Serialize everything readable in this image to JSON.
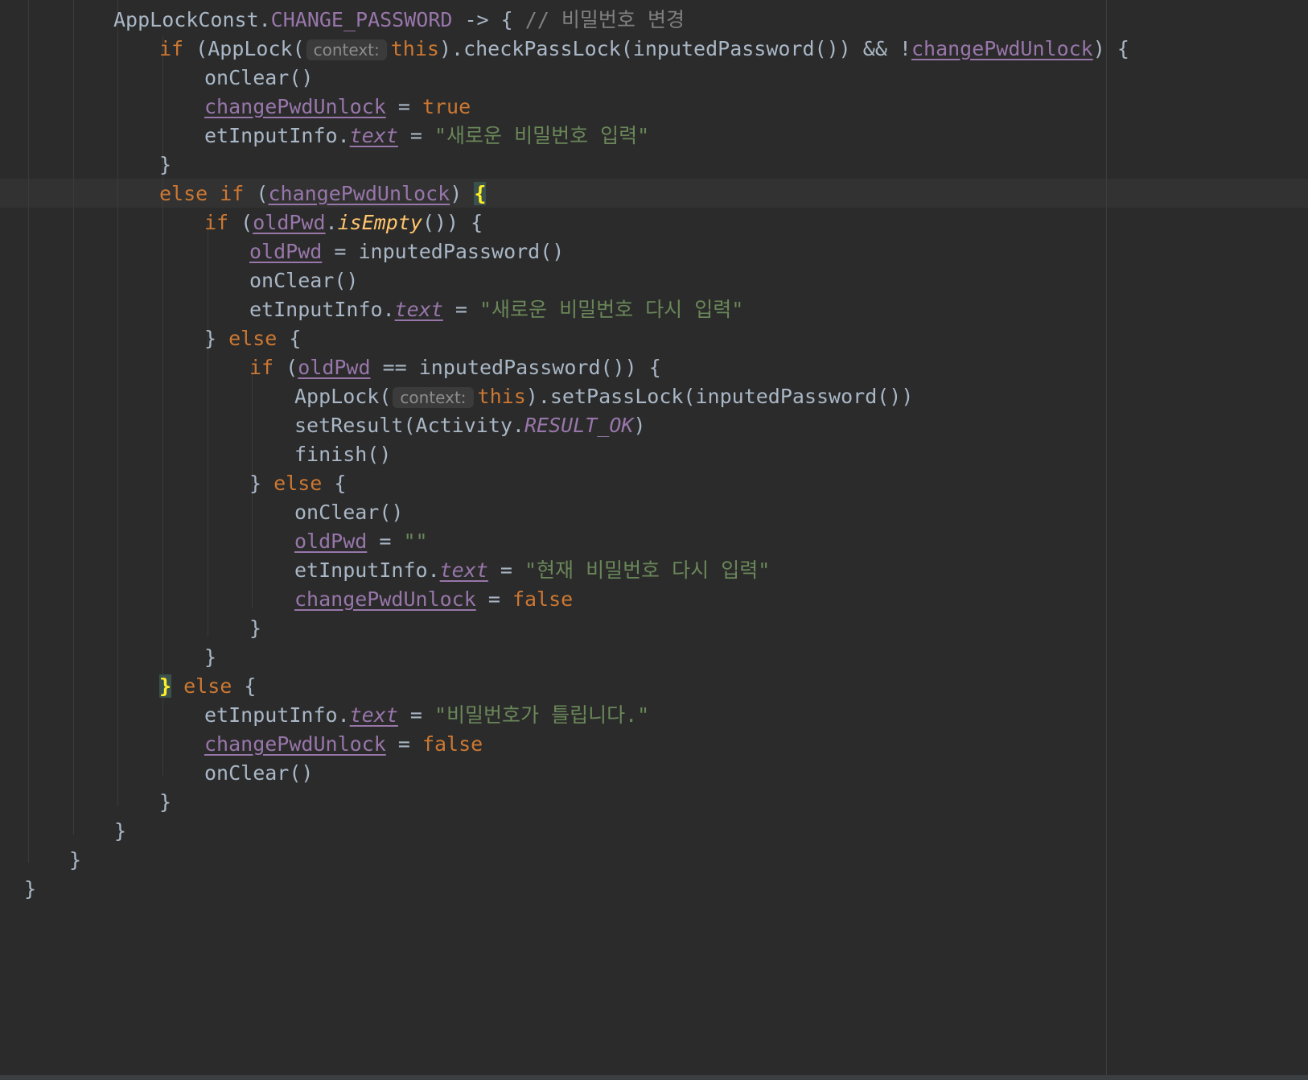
{
  "hints": {
    "context": "context:"
  },
  "code": {
    "l1": {
      "a": "AppLockConst.",
      "b": "CHANGE_PASSWORD",
      "c": " -> { ",
      "d": "// 비밀번호 변경"
    },
    "l2": {
      "a": "if",
      "b": " (AppLock(",
      "c": "this",
      "d": ").checkPassLock(inputedPassword()) && !",
      "e": "changePwdUnlock",
      "f": ") {"
    },
    "l3": {
      "a": "onClear()"
    },
    "l4": {
      "a": "changePwdUnlock",
      "b": " = ",
      "c": "true"
    },
    "l5": {
      "a": "etInputInfo.",
      "b": "text",
      "c": " = ",
      "d": "\"새로운 비밀번호 입력\""
    },
    "l6": {
      "a": "}"
    },
    "l7": {
      "a": "else if",
      "b": " (",
      "c": "changePwdUnlock",
      "d": ") ",
      "e": "{"
    },
    "l8": {
      "a": "if",
      "b": " (",
      "c": "oldPwd",
      "d": ".",
      "e": "isEmpty",
      "f": "()) {"
    },
    "l9": {
      "a": "oldPwd",
      "b": " = inputedPassword()"
    },
    "l10": {
      "a": "onClear()"
    },
    "l11": {
      "a": "etInputInfo.",
      "b": "text",
      "c": " = ",
      "d": "\"새로운 비밀번호 다시 입력\""
    },
    "l12": {
      "a": "} ",
      "b": "else",
      "c": " {"
    },
    "l13": {
      "a": "if",
      "b": " (",
      "c": "oldPwd",
      "d": " == inputedPassword()) {"
    },
    "l14": {
      "a": "AppLock(",
      "b": "this",
      "c": ").setPassLock(inputedPassword())"
    },
    "l15": {
      "a": "setResult(Activity.",
      "b": "RESULT_OK",
      "c": ")"
    },
    "l16": {
      "a": "finish()"
    },
    "l17": {
      "a": "} ",
      "b": "else",
      "c": " {"
    },
    "l18": {
      "a": "onClear()"
    },
    "l19": {
      "a": "oldPwd",
      "b": " = ",
      "c": "\"\""
    },
    "l20": {
      "a": "etInputInfo.",
      "b": "text",
      "c": " = ",
      "d": "\"현재 비밀번호 다시 입력\""
    },
    "l21": {
      "a": "changePwdUnlock",
      "b": " = ",
      "c": "false"
    },
    "l22": {
      "a": "}"
    },
    "l23": {
      "a": "}"
    },
    "l24": {
      "a": "}",
      "b": " ",
      "c": "else",
      "d": " {"
    },
    "l25": {
      "a": "etInputInfo.",
      "b": "text",
      "c": " = ",
      "d": "\"비밀번호가 틀립니다.\""
    },
    "l26": {
      "a": "changePwdUnlock",
      "b": " = ",
      "c": "false"
    },
    "l27": {
      "a": "onClear()"
    },
    "l28": {
      "a": "}"
    },
    "l29": {
      "a": "}"
    },
    "l30": {
      "a": "}"
    },
    "l31": {
      "a": "}"
    }
  }
}
